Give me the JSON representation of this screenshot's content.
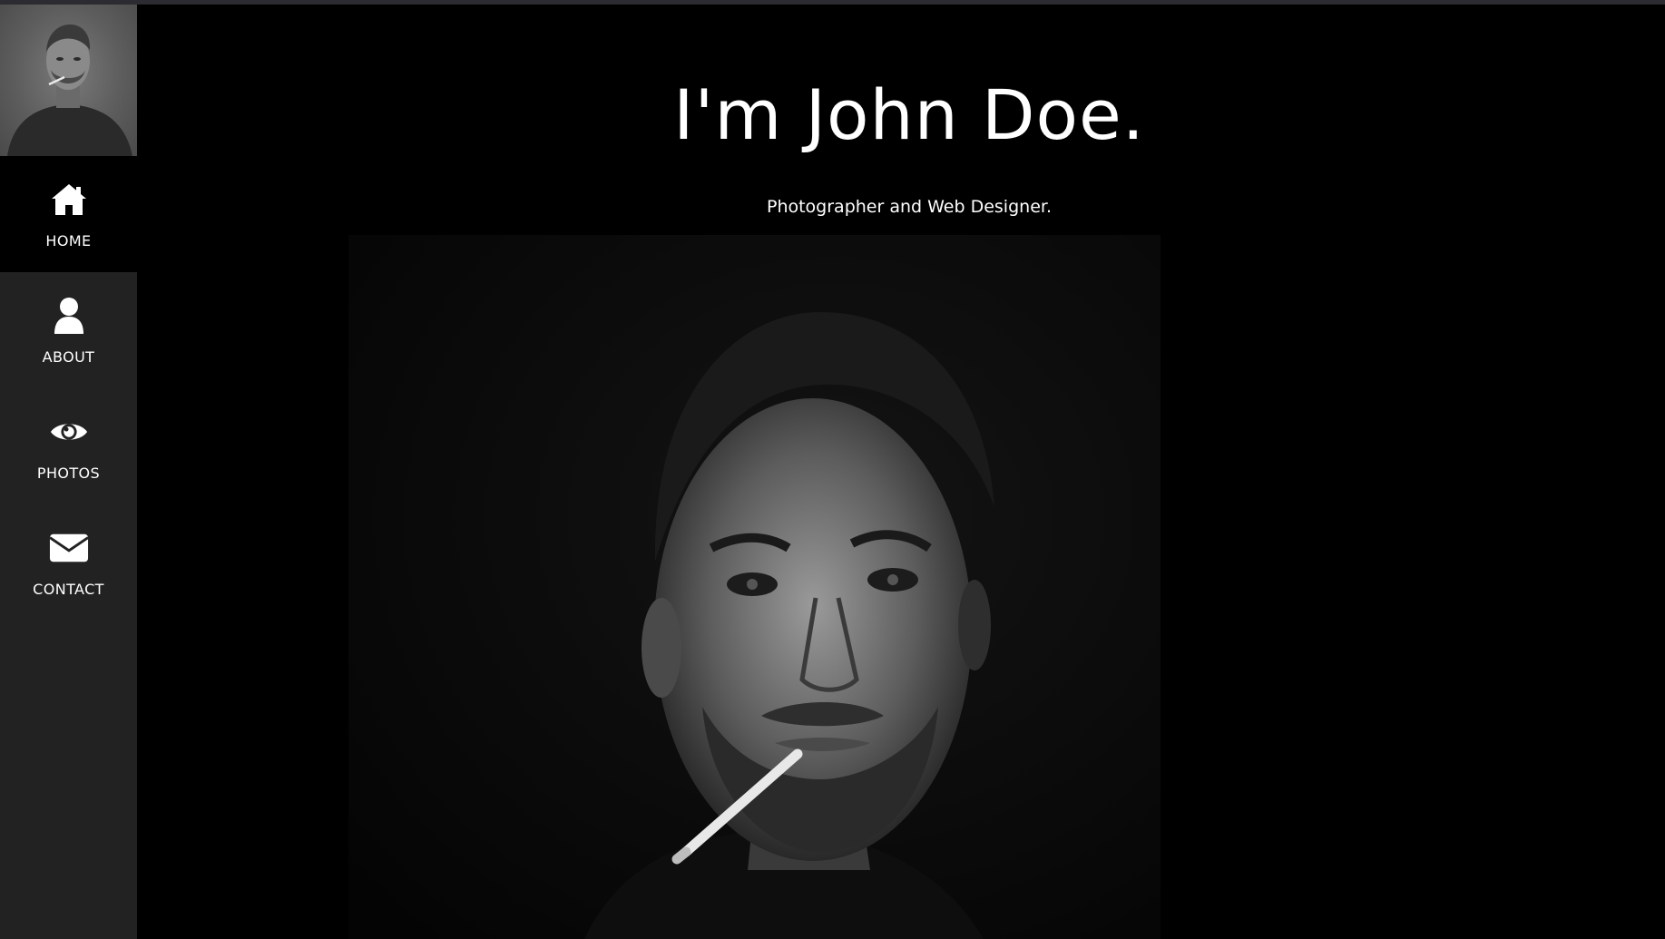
{
  "sidebar": {
    "avatar_icon": "portrait-thumbnail",
    "items": [
      {
        "label": "HOME",
        "icon": "home-icon",
        "active": true
      },
      {
        "label": "ABOUT",
        "icon": "user-icon",
        "active": false
      },
      {
        "label": "PHOTOS",
        "icon": "eye-icon",
        "active": false
      },
      {
        "label": "CONTACT",
        "icon": "envelope-icon",
        "active": false
      }
    ]
  },
  "main": {
    "title": "I'm John Doe.",
    "subtitle": "Photographer and Web Designer."
  },
  "colors": {
    "sidebar_bg": "#222222",
    "active_bg": "#000000",
    "page_bg": "#000000",
    "text": "#ffffff"
  }
}
